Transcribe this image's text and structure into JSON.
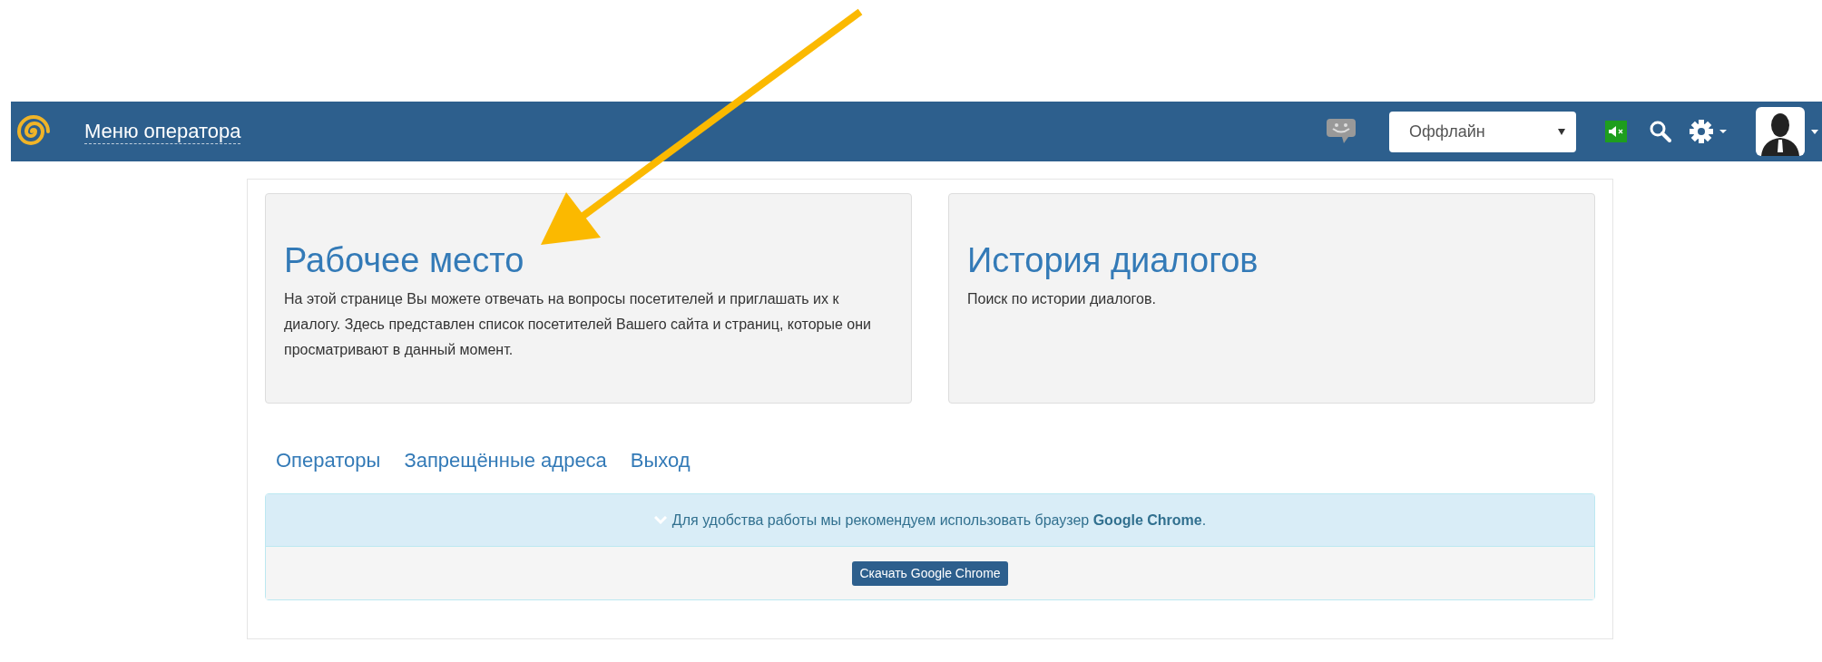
{
  "navbar": {
    "title": "Меню оператора",
    "status_select": {
      "value": "Оффлайн"
    }
  },
  "cards": [
    {
      "title": "Рабочее место",
      "text": "На этой странице Вы можете отвечать на вопросы посетителей и приглашать их к диалогу. Здесь представлен список посетителей Вашего сайта и страниц, которые они просматривают в данный момент."
    },
    {
      "title": "История диалогов",
      "text": "Поиск по истории диалогов."
    }
  ],
  "links": [
    "Операторы",
    "Запрещённые адреса",
    "Выход"
  ],
  "alert": {
    "text": "Для удобства работы мы рекомендуем использовать браузер **Google Chrome**.",
    "button": "Скачать Google Chrome"
  }
}
